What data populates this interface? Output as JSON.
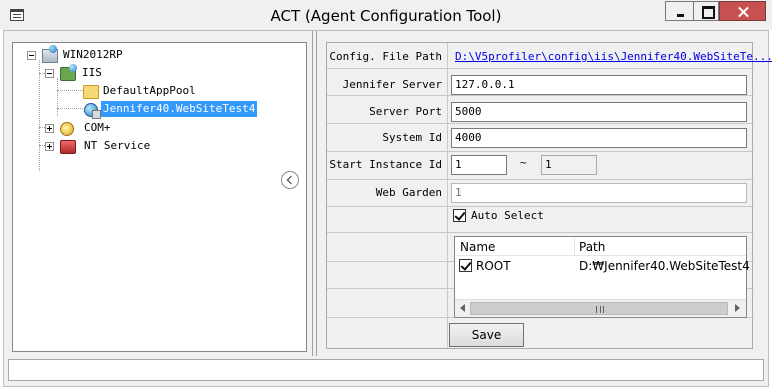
{
  "window": {
    "title": "ACT (Agent Configuration Tool)"
  },
  "tree": {
    "root": {
      "label": "WIN2012RP",
      "icon": "server-globe-icon"
    },
    "iis": {
      "label": "IIS",
      "icon": "iis-icon"
    },
    "app_pool": {
      "label": "DefaultAppPool",
      "icon": "folder-icon"
    },
    "site": {
      "label": "Jennifer40.WebSiteTest4",
      "icon": "website-globe-icon",
      "selected": true
    },
    "com": {
      "label": "COM+",
      "icon": "com-plus-icon"
    },
    "nt_service": {
      "label": "NT Service",
      "icon": "nt-service-icon"
    }
  },
  "props": {
    "config_file_path": {
      "label": "Config. File Path",
      "value": "D:\\V5profiler\\config\\iis\\Jennifer40.WebSiteTe..."
    },
    "jennifer_server": {
      "label": "Jennifer Server",
      "value": "127.0.0.1"
    },
    "server_port": {
      "label": "Server Port",
      "value": "5000"
    },
    "system_id": {
      "label": "System Id",
      "value": "4000"
    },
    "start_instance_id": {
      "label": "Start Instance Id",
      "value": "1",
      "separator": "~",
      "end_value": "1"
    },
    "web_garden": {
      "label": "Web Garden",
      "value": "1"
    },
    "auto_select": {
      "label": "Auto Select",
      "checked": true
    }
  },
  "app_list": {
    "columns": [
      "Name",
      "Path"
    ],
    "rows": [
      {
        "checked": true,
        "name": "ROOT",
        "path": "D:₩Jennifer40.WebSiteTest4"
      }
    ]
  },
  "buttons": {
    "save": "Save"
  }
}
